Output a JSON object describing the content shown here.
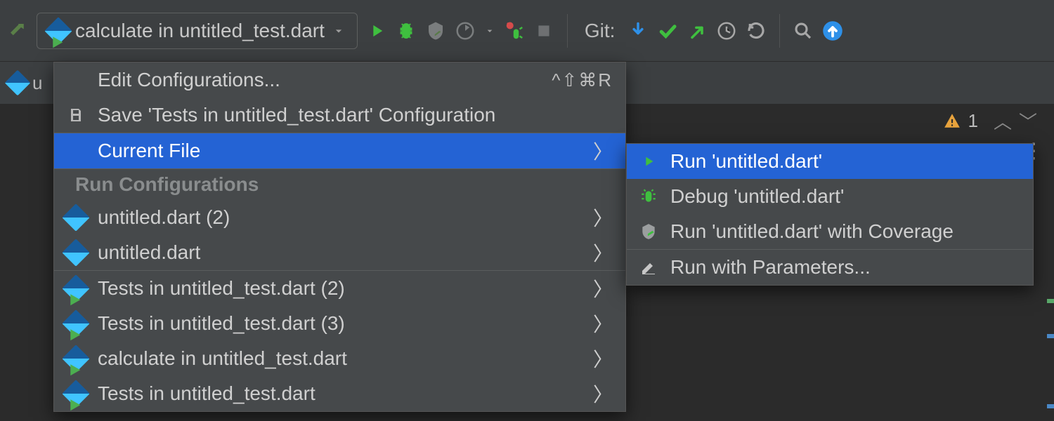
{
  "toolbar": {
    "run_config_label": "calculate in untitled_test.dart",
    "git_label": "Git:"
  },
  "tab": {
    "filename_first_letter": "u"
  },
  "problems": {
    "warning_count": "1"
  },
  "menu": {
    "edit_configs": "Edit Configurations...",
    "edit_configs_shortcut": "^⇧⌘R",
    "save_config": "Save 'Tests in untitled_test.dart' Configuration",
    "current_file": "Current File",
    "section_header": "Run Configurations",
    "items": [
      {
        "label": "untitled.dart (2)",
        "type": "dart"
      },
      {
        "label": "untitled.dart",
        "type": "dart"
      },
      {
        "label": "Tests in untitled_test.dart (2)",
        "type": "test"
      },
      {
        "label": "Tests in untitled_test.dart (3)",
        "type": "test"
      },
      {
        "label": "calculate in untitled_test.dart",
        "type": "test"
      },
      {
        "label": "Tests in untitled_test.dart",
        "type": "test"
      }
    ]
  },
  "submenu": {
    "run": "Run 'untitled.dart'",
    "debug": "Debug 'untitled.dart'",
    "coverage": "Run 'untitled.dart' with Coverage",
    "params": "Run with Parameters..."
  }
}
